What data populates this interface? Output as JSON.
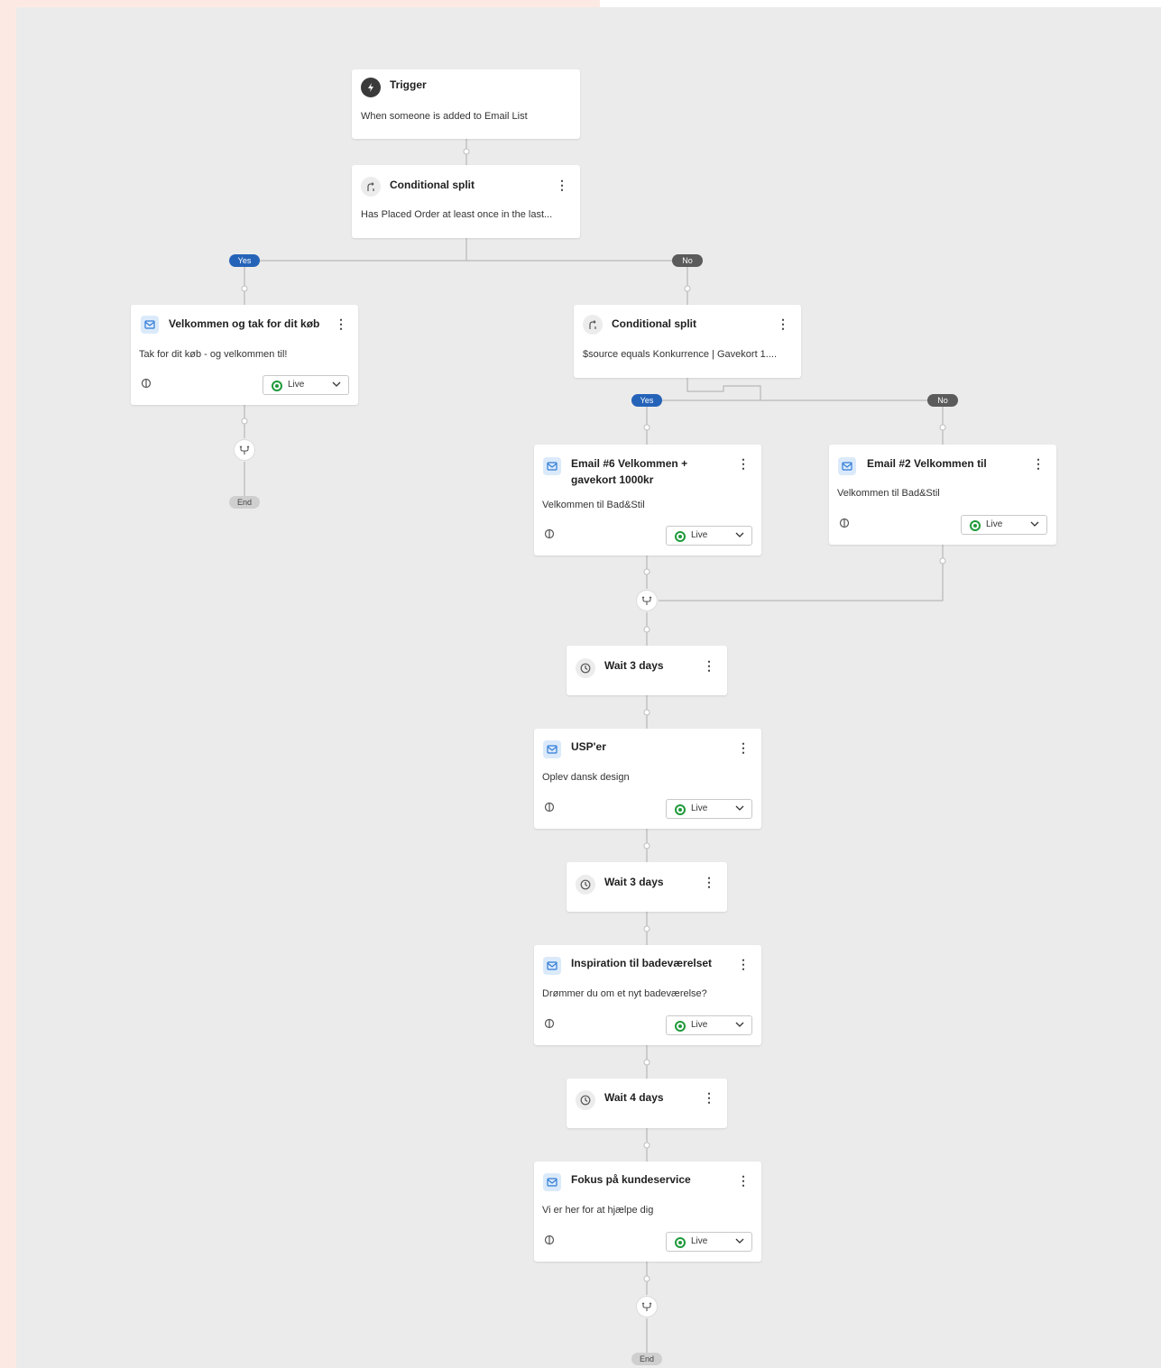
{
  "trigger": {
    "title": "Trigger",
    "desc": "When someone is added to Email List"
  },
  "split1": {
    "title": "Conditional split",
    "desc": "Has Placed Order at least once in the last..."
  },
  "split1_yes": "Yes",
  "split1_no": "No",
  "email_left": {
    "title": "Velkommen og tak for dit køb",
    "desc": "Tak for dit køb - og velkommen til!",
    "status": "Live"
  },
  "end_left": "End",
  "split2": {
    "title": "Conditional split",
    "desc": "$source equals Konkurrence | Gavekort 1...."
  },
  "split2_yes": "Yes",
  "split2_no": "No",
  "email6": {
    "title_line1": "Email #6 Velkommen +",
    "title_line2": "gavekort 1000kr",
    "desc": "Velkommen til Bad&Stil",
    "status": "Live"
  },
  "email2": {
    "title": "Email #2 Velkommen til",
    "desc": "Velkommen til Bad&Stil",
    "status": "Live"
  },
  "wait1": "Wait 3 days",
  "usp": {
    "title": "USP'er",
    "desc": "Oplev dansk design",
    "status": "Live"
  },
  "wait2": "Wait 3 days",
  "inspiration": {
    "title": "Inspiration til badeværelset",
    "desc": "Drømmer du om et nyt badeværelse?",
    "status": "Live"
  },
  "wait3": "Wait 4 days",
  "kundeservice": {
    "title": "Fokus på kundeservice",
    "desc": "Vi er her for at hjælpe dig",
    "status": "Live"
  },
  "end_main": "End",
  "icons": {
    "trigger": "lightning-icon",
    "split": "split-icon",
    "email": "envelope-icon",
    "wait": "clock-icon",
    "merge": "merge-icon",
    "menu": "kebab-menu-icon",
    "stats": "stats-icon",
    "dropdown": "chevron-down-icon"
  },
  "colors": {
    "yes": "#2563b8",
    "no": "#5b5b5b",
    "live": "#1f9a3a",
    "canvas": "#ebebeb",
    "margin": "#fde9e3"
  }
}
